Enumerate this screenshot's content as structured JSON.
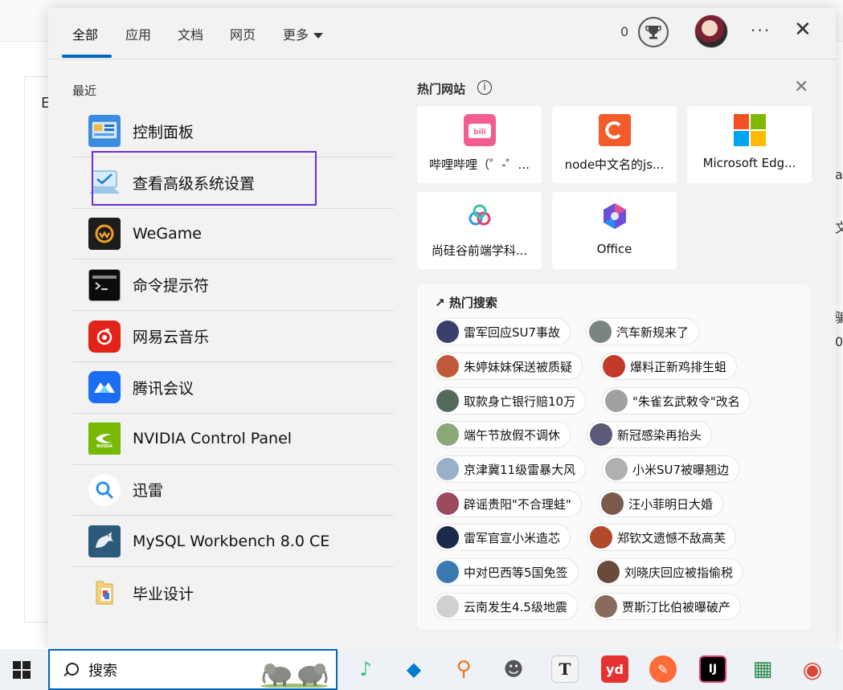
{
  "background": {
    "left_chars": [
      "E"
    ],
    "right_chars": [
      "a",
      "文",
      "骗",
      "0"
    ]
  },
  "tabs": [
    {
      "label": "全部",
      "active": true
    },
    {
      "label": "应用",
      "active": false
    },
    {
      "label": "文档",
      "active": false
    },
    {
      "label": "网页",
      "active": false
    },
    {
      "label": "更多",
      "active": false
    }
  ],
  "header": {
    "points": "0",
    "more_dots": "···",
    "close_glyph": "✕"
  },
  "recent": {
    "title": "最近",
    "items": [
      {
        "label": "控制面板",
        "icon": "control-panel-icon",
        "color": "#3a8de0"
      },
      {
        "label": "查看高级系统设置",
        "icon": "system-settings-icon",
        "color": "#4a9bd8"
      },
      {
        "label": "WeGame",
        "icon": "wegame-icon",
        "color": "#1c1c1c"
      },
      {
        "label": "命令提示符",
        "icon": "cmd-icon",
        "color": "#0c0c0c"
      },
      {
        "label": "网易云音乐",
        "icon": "netease-music-icon",
        "color": "#e2231a"
      },
      {
        "label": "腾讯会议",
        "icon": "tencent-meeting-icon",
        "color": "#1b6ef3"
      },
      {
        "label": "NVIDIA Control Panel",
        "icon": "nvidia-icon",
        "color": "#76b900"
      },
      {
        "label": "迅雷",
        "icon": "xunlei-icon",
        "color": "#ffffff"
      },
      {
        "label": "MySQL Workbench 8.0 CE",
        "icon": "mysql-workbench-icon",
        "color": "#2d5a7b"
      },
      {
        "label": "毕业设计",
        "icon": "folder-icon",
        "color": "#f3d27a"
      }
    ]
  },
  "hot_sites": {
    "title": "热门网站",
    "info_glyph": "i",
    "close_glyph": "✕",
    "items": [
      {
        "label": "哔哩哔哩（゜-゜...",
        "icon": "bilibili-icon",
        "color": "#f25d8e"
      },
      {
        "label": "node中文名的js...",
        "icon": "c-icon",
        "color": "#f45b2a"
      },
      {
        "label": "Microsoft Edg...",
        "icon": "microsoft-icon",
        "color": "#f25022"
      },
      {
        "label": "尚硅谷前端学科...",
        "icon": "atguigu-icon",
        "color": "#2b9de8"
      },
      {
        "label": "Office",
        "icon": "office-icon",
        "color": "#6b4fd8"
      }
    ]
  },
  "hot_search": {
    "title": "热门搜索",
    "arrow_glyph": "↗",
    "items": [
      {
        "label": "雷军回应SU7事故",
        "color": "#3a3f6b"
      },
      {
        "label": "汽车新规来了",
        "color": "#7a8580"
      },
      {
        "label": "朱婷妹妹保送被质疑",
        "color": "#c05a3a"
      },
      {
        "label": "爆料正新鸡排生蛆",
        "color": "#c23a2a"
      },
      {
        "label": "取款身亡银行赔10万",
        "color": "#556b5a"
      },
      {
        "label": "\"朱雀玄武敕令\"改名",
        "color": "#a0a0a0"
      },
      {
        "label": "端午节放假不调休",
        "color": "#8aa878"
      },
      {
        "label": "新冠感染再抬头",
        "color": "#5a5a7a"
      },
      {
        "label": "京津冀11级雷暴大风",
        "color": "#9ab0c8"
      },
      {
        "label": "小米SU7被曝翘边",
        "color": "#b0b0b0"
      },
      {
        "label": "辟谣贵阳\"不合理蛙\"",
        "color": "#9a4a5a"
      },
      {
        "label": "汪小菲明日大婚",
        "color": "#7a5a4a"
      },
      {
        "label": "雷军官宣小米造芯",
        "color": "#1c2a4a"
      },
      {
        "label": "郑钦文遗憾不敌高芙",
        "color": "#b04a2a"
      },
      {
        "label": "中对巴西等5国免签",
        "color": "#3a7ab0"
      },
      {
        "label": "刘晓庆回应被指偷税",
        "color": "#6a4a3a"
      },
      {
        "label": "云南发生4.5级地震",
        "color": "#d0d0d0"
      },
      {
        "label": "贾斯汀比伯被曝破产",
        "color": "#8a6a5a"
      }
    ]
  },
  "taskbar": {
    "search_label": "搜索",
    "apps": [
      {
        "name": "qq-music-icon",
        "glyph": "♪",
        "color": "#31c27c"
      },
      {
        "name": "vscode-icon",
        "glyph": "◆",
        "color": "#007acc"
      },
      {
        "name": "everything-search-icon",
        "glyph": "⚲",
        "color": "#f07a1a"
      },
      {
        "name": "anime-avatar-app-icon",
        "glyph": "☻",
        "color": "#555555"
      },
      {
        "name": "typora-icon",
        "glyph": "T",
        "color": "#222222"
      },
      {
        "name": "youdao-icon",
        "glyph": "yd",
        "color": "#e63131"
      },
      {
        "name": "postman-icon",
        "glyph": "✎",
        "color": "#ff6c37"
      },
      {
        "name": "intellij-icon",
        "glyph": "IJ",
        "color": "#000000"
      },
      {
        "name": "app-grid-icon",
        "glyph": "▦",
        "color": "#2a8a4a"
      },
      {
        "name": "chrome-icon",
        "glyph": "◉",
        "color": "#db4437"
      }
    ]
  }
}
